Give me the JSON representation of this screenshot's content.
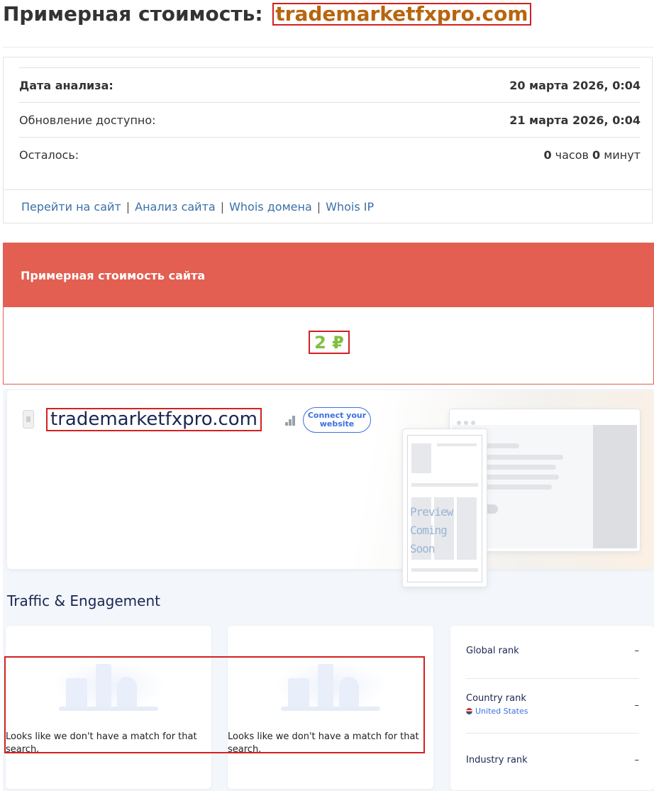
{
  "header": {
    "title_prefix": "Примерная стоимость:",
    "domain": "trademarketfxpro.com"
  },
  "analysis": {
    "rows": [
      {
        "label": "Дата анализа:",
        "value": "20 марта 2026, 0:04"
      },
      {
        "label": "Обновление доступно:",
        "value": "21 марта 2026, 0:04"
      },
      {
        "label": "Осталось:",
        "hours": "0",
        "hours_unit": "часов",
        "minutes": "0",
        "minutes_unit": "минут"
      }
    ],
    "links": [
      "Перейти на сайт",
      "Анализ сайта",
      "Whois домена",
      "Whois IP"
    ],
    "separator": "|"
  },
  "valuation": {
    "header": "Примерная стоимость сайта",
    "amount": "2 ₽"
  },
  "similarweb": {
    "domain": "trademarketfxpro.com",
    "connect_button": "Connect your website",
    "preview_line1": "Preview",
    "preview_line2": "Coming Soon",
    "section_title": "Traffic & Engagement",
    "empty_message": "Looks like we don't have a match for that search.",
    "ranks": [
      {
        "label": "Global rank",
        "value": "–"
      },
      {
        "label": "Country rank",
        "value": "–",
        "country": "United States"
      },
      {
        "label": "Industry rank",
        "value": "–"
      }
    ]
  },
  "colors": {
    "title_domain": "#b8650e",
    "valuation_header_bg": "#e35f51",
    "amount": "#7fbf3f",
    "link": "#3a6fa8",
    "highlight": "#d42020"
  }
}
